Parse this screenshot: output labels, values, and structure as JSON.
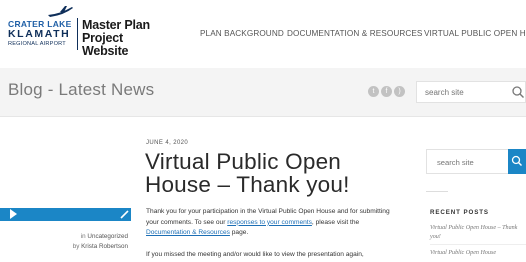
{
  "logo": {
    "line1": "CRATER LAKE",
    "line2": "KLAMATH",
    "line3": "REGIONAL AIRPORT",
    "title_line1": "Master Plan",
    "title_line2": "Project Website"
  },
  "nav": {
    "items": [
      "PLAN BACKGROUND",
      "DOCUMENTATION & RESOURCES",
      "VIRTUAL PUBLIC OPEN HOUSE"
    ]
  },
  "band": {
    "title": "Blog - Latest News",
    "search_placeholder": "search site",
    "social_icons": [
      "twitter-icon",
      "facebook-icon",
      "rss-icon"
    ]
  },
  "post": {
    "date": "JUNE 4, 2020",
    "title": "Virtual Public Open House – Thank you!",
    "category_prefix": "in",
    "category": "Uncategorized",
    "author_prefix": "by",
    "author": "Krista Robertson",
    "p1_text1": "Thank you for your participation in the Virtual Public Open House and for submitting your comments. To see our ",
    "p1_link1": "responses to your comments",
    "p1_text2": ", please visit the ",
    "p1_link2": "Documentation & Resources",
    "p1_text3": " page.",
    "p2_text": "If you missed the meeting and/or would like to view the presentation again,"
  },
  "sidebar": {
    "search_placeholder": "search site",
    "recent_heading": "RECENT POSTS",
    "recent_posts": [
      "Virtual Public Open House – Thank you!",
      "Virtual Public Open House"
    ]
  },
  "colors": {
    "accent": "#1b86c6",
    "logo_dark": "#0f2f5a",
    "band_bg": "#f4f4f4"
  }
}
